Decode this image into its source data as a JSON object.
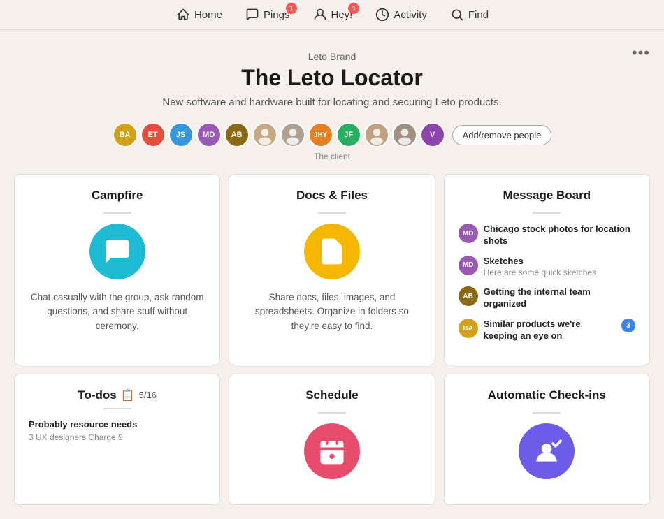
{
  "nav": {
    "items": [
      {
        "id": "home",
        "label": "Home",
        "badge": null,
        "icon": "home"
      },
      {
        "id": "pings",
        "label": "Pings",
        "badge": "1",
        "icon": "pings"
      },
      {
        "id": "hey",
        "label": "Hey!",
        "badge": "1",
        "icon": "hey"
      },
      {
        "id": "activity",
        "label": "Activity",
        "badge": null,
        "icon": "activity"
      },
      {
        "id": "find",
        "label": "Find",
        "badge": null,
        "icon": "find"
      }
    ]
  },
  "project": {
    "brand": "Leto Brand",
    "title": "The Leto Locator",
    "description": "New software and hardware built for locating and securing Leto products.",
    "client_label": "The client",
    "add_people_label": "Add/remove people"
  },
  "avatars": [
    {
      "id": "BA",
      "color": "#e8c84a",
      "type": "initials"
    },
    {
      "id": "ET",
      "color": "#e74c3c",
      "type": "initials"
    },
    {
      "id": "JS",
      "color": "#3498db",
      "type": "initials"
    },
    {
      "id": "MD",
      "color": "#9b59b6",
      "type": "initials"
    },
    {
      "id": "AB",
      "color": "#8B6914",
      "type": "initials"
    },
    {
      "id": "photo1",
      "color": "#ccc",
      "type": "photo"
    },
    {
      "id": "photo2",
      "color": "#ccc",
      "type": "photo"
    },
    {
      "id": "JHY",
      "color": "#e67e22",
      "type": "initials"
    },
    {
      "id": "JF",
      "color": "#2ecc71",
      "type": "initials"
    },
    {
      "id": "photo3",
      "color": "#ccc",
      "type": "photo"
    },
    {
      "id": "photo4",
      "color": "#ccc",
      "type": "photo"
    },
    {
      "id": "V",
      "color": "#8e44ad",
      "type": "initials"
    }
  ],
  "cards": {
    "campfire": {
      "title": "Campfire",
      "description": "Chat casually with the group, ask random questions, and share stuff without ceremony.",
      "icon_color": "#1dbcd4"
    },
    "docs": {
      "title": "Docs & Files",
      "description": "Share docs, files, images, and spreadsheets. Organize in folders so they're easy to find.",
      "icon_color": "#f5b700"
    },
    "message_board": {
      "title": "Message Board",
      "messages": [
        {
          "avatar": "MD",
          "avatar_color": "#9b59b6",
          "title": "Chicago stock photos for location shots",
          "sub": null,
          "badge": null
        },
        {
          "avatar": "MD",
          "avatar_color": "#9b59b6",
          "title": "Sketches",
          "sub": "Here are some quick sketches",
          "badge": null
        },
        {
          "avatar": "AB",
          "avatar_color": "#8B6914",
          "title": "Getting the internal team organized",
          "sub": null,
          "badge": null
        },
        {
          "avatar": "BA",
          "avatar_color": "#e8c84a",
          "title": "Similar products we're keeping an eye on",
          "sub": null,
          "badge": "3"
        }
      ]
    },
    "todos": {
      "title": "To-dos",
      "progress": "5/16",
      "item_title": "Probably resource needs",
      "item_sub": "3 UX designers  Charge 9"
    },
    "schedule": {
      "title": "Schedule",
      "icon_color": "#e74c6a"
    },
    "checkins": {
      "title": "Automatic Check-ins",
      "icon_color": "#6c5ce7"
    }
  },
  "more_button_label": "•••"
}
